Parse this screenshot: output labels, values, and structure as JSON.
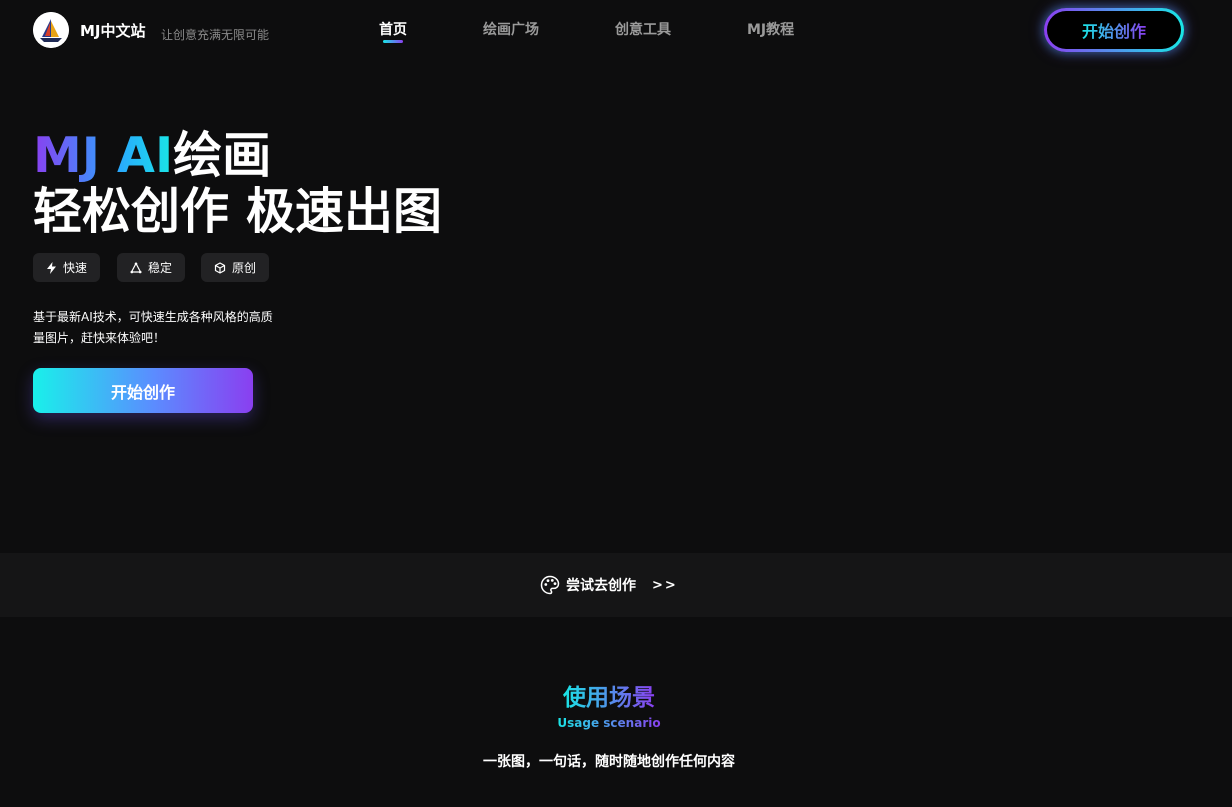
{
  "header": {
    "brand": "MJ中文站",
    "slogan": "让创意充满无限可能",
    "nav": [
      {
        "label": "首页",
        "active": true
      },
      {
        "label": "绘画广场",
        "active": false
      },
      {
        "label": "创意工具",
        "active": false
      },
      {
        "label": "MJ教程",
        "active": false
      }
    ],
    "cta_label": "开始创作"
  },
  "hero": {
    "title_highlight": "MJ AI",
    "title_rest": "绘画",
    "title_line2": "轻松创作 极速出图",
    "tags": [
      {
        "icon": "bolt-icon",
        "label": "快速"
      },
      {
        "icon": "triangle-nodes-icon",
        "label": "稳定"
      },
      {
        "icon": "cube-icon",
        "label": "原创"
      }
    ],
    "description": "基于最新AI技术，可快速生成各种风格的高质量图片，赶快来体验吧！",
    "cta_label": "开始创作"
  },
  "try_strip": {
    "icon": "palette-icon",
    "label": "尝试去创作",
    "arrows": ">>"
  },
  "scenario": {
    "title": "使用场景",
    "subtitle": "Usage scenario",
    "description": "一张图，一句话，随时随地创作任何内容"
  },
  "colors": {
    "background": "#0d0d0e",
    "strip_background": "#151516",
    "accent_cyan": "#19e6e6",
    "accent_purple": "#8a3ff0",
    "tag_background": "#222224"
  }
}
